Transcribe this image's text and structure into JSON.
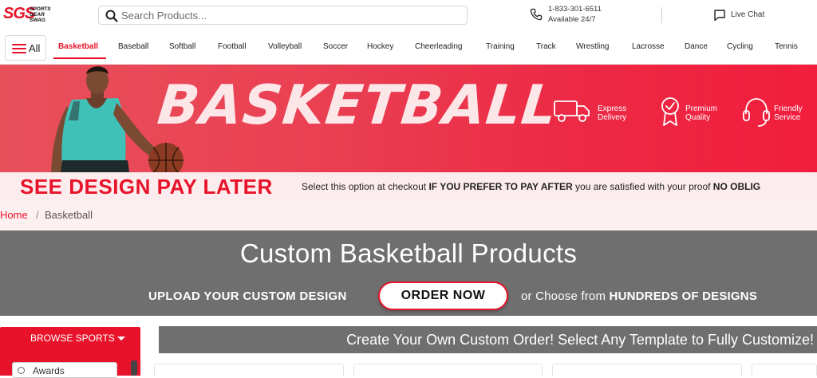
{
  "header": {
    "logo_text": "SGS",
    "logo_sub": "SPORTS GEAR SWAG",
    "search_placeholder": "Search Products...",
    "phone_number": "1-833-301-6511",
    "phone_availability": "Available 24/7",
    "chat_label": "Live Chat"
  },
  "nav": {
    "all_label": "All",
    "items": [
      "Basketball",
      "Baseball",
      "Softball",
      "Football",
      "Volleyball",
      "Soccer",
      "Hockey",
      "Cheerleading",
      "Training",
      "Track",
      "Wrestling",
      "Lacrosse",
      "Dance",
      "Cycling",
      "Tennis"
    ],
    "active": "Basketball"
  },
  "hero": {
    "title": "BASKETBALL",
    "features": [
      {
        "line1": "Express",
        "line2": "Delivery",
        "icon": "truck-icon"
      },
      {
        "line1": "Premium",
        "line2": "Quality",
        "icon": "medal-icon"
      },
      {
        "line1": "Friendly",
        "line2": "Service",
        "icon": "headset-icon"
      }
    ]
  },
  "promo": {
    "headline": "SEE DESIGN PAY LATER",
    "text_1": "Select this option at checkout ",
    "text_bold": "IF YOU PREFER TO PAY AFTER",
    "text_2": " you are satisfied with your proof ",
    "text_bold_2": "NO OBLIG"
  },
  "breadcrumb": {
    "home": "Home",
    "separator": "/",
    "current": "Basketball"
  },
  "banner": {
    "title": "Custom Basketball Products",
    "upload_label": "UPLOAD YOUR CUSTOM DESIGN",
    "order_button": "ORDER NOW",
    "choose_prefix": "or Choose from ",
    "choose_bold": "HUNDREDS OF DESIGNS"
  },
  "sidebar": {
    "browse_label": "BROWSE SPORTS",
    "items": [
      "Awards"
    ]
  },
  "main": {
    "create_text": "Create Your Own Custom Order! Select Any Template to Fully Customize!"
  },
  "colors": {
    "brand_red": "#e8132a",
    "banner_gray": "#6f6f6f",
    "promo_bg": "#fdeced"
  }
}
